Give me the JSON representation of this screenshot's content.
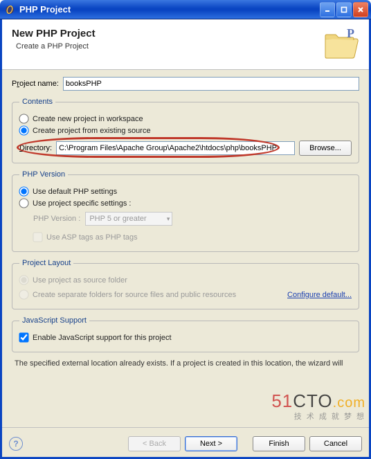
{
  "window": {
    "title": "PHP Project"
  },
  "banner": {
    "heading": "New PHP Project",
    "subtitle": "Create a PHP Project"
  },
  "project_name": {
    "label_pre": "P",
    "label_u": "r",
    "label_post": "oject name:",
    "value": "booksPHP"
  },
  "contents": {
    "legend": "Contents",
    "opt_workspace": "Create new project in workspace",
    "opt_existing": "Create project from existing source",
    "selected": "existing",
    "directory_label_pre": "",
    "directory_label_u": "D",
    "directory_label_post": "irectory:",
    "directory_value": "C:\\Program Files\\Apache Group\\Apache2\\htdocs\\php\\booksPHP",
    "browse_label": "Browse..."
  },
  "php_version": {
    "legend": "PHP Version",
    "opt_default": "Use default PHP settings",
    "opt_specific": "Use project specific settings :",
    "selected": "default",
    "version_label": "PHP Version :",
    "version_value": "PHP 5 or greater",
    "asp_label": "Use ASP tags as PHP tags",
    "asp_checked": false
  },
  "layout": {
    "legend": "Project Layout",
    "opt_srcfolder": "Use project as source folder",
    "opt_separate": "Create separate folders for source files and public resources",
    "configure_link": "Configure default..."
  },
  "js": {
    "legend": "JavaScript Support",
    "enable_label": "Enable JavaScript support for this project",
    "checked": true
  },
  "footer_note": "The specified external location already exists. If a project is created in this location, the wizard will",
  "buttons": {
    "back": "< Back",
    "next": "Next >",
    "finish": "Finish",
    "cancel": "Cancel"
  },
  "watermark": {
    "part1": "51",
    "part2": "CTO",
    "part3": ".com",
    "tagline": "技 术 成 就 梦 想"
  }
}
